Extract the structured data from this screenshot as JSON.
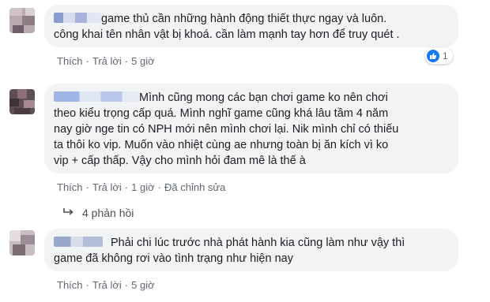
{
  "comments": [
    {
      "lines": [
        "game thủ cần những hành động thiết thực ngay và luôn.",
        "công khai tên nhân vật bị khoá. cần làm mạnh tay hơn để truy quét ."
      ],
      "actions": {
        "like": "Thích",
        "reply": "Trả lời",
        "time": "5 giờ"
      },
      "reaction": {
        "icon": "like-icon",
        "count": "1"
      }
    },
    {
      "lines": [
        "Mình cũng mong các bạn chơi game ko nên chơi",
        "theo kiểu trọng cấp quá. Mình nghĩ game cũng khá lâu tầm 4 năm",
        "nay giờ nge tin có NPH mới nên mình chơi lại. Nik mình chỉ có thiếu",
        "ta thôi ko vip. Muốn vào nhiệt cùng ae nhưng toàn bị ăn kích vì ko",
        "vip + cấp thấp. Vậy cho mình hỏi đam mê là thế à"
      ],
      "actions": {
        "like": "Thích",
        "reply": "Trả lời",
        "time": "1 giờ",
        "edited": "Đã chỉnh sửa"
      },
      "replies": "4 phản hồi"
    },
    {
      "lines": [
        "Phải chi lúc trước nhà phát hành kia cũng làm như vậy thì",
        "game đã không rơi vào tình trạng như hiện nay"
      ],
      "actions": {
        "like": "Thích",
        "reply": "Trả lời",
        "time": "5 giờ"
      }
    }
  ],
  "colors": {
    "bubble": "#f2f3f5",
    "like_blue": "#1877f2",
    "meta_gray": "#606770"
  }
}
